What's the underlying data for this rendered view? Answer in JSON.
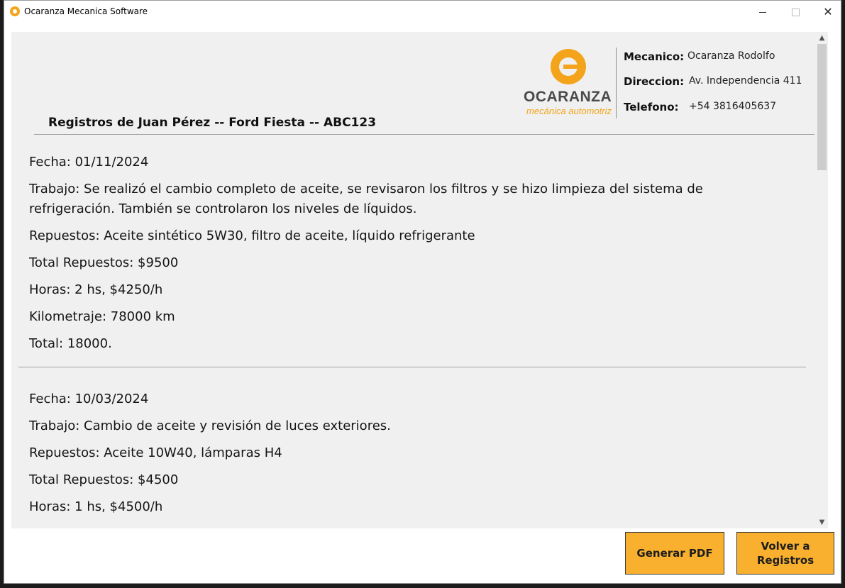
{
  "window": {
    "title": "Ocaranza Mecanica Software"
  },
  "logo": {
    "name": "OCARANZA",
    "subtitle": "mecánica automotriz"
  },
  "info": {
    "mecanico_label": "Mecanico:",
    "mecanico_value": "Ocaranza Rodolfo",
    "direccion_label": "Direccion:",
    "direccion_value": "Av. Independencia 411",
    "telefono_label": "Telefono:",
    "telefono_value": "+54 3816405637"
  },
  "records_title": "Registros de Juan Pérez -- Ford Fiesta -- ABC123",
  "records": [
    {
      "fecha": "Fecha: 01/11/2024",
      "trabajo_line1": "Trabajo: Se realizó el cambio completo de aceite, se revisaron los filtros y se hizo limpieza del sistema de",
      "trabajo_line2": "refrigeración. También se controlaron los niveles de líquidos.",
      "repuestos": "Repuestos: Aceite sintético 5W30, filtro de aceite, líquido refrigerante",
      "total_repuestos": "Total Repuestos: $9500",
      "horas": "Horas: 2 hs, $4250/h",
      "kilometraje": "Kilometraje: 78000 km",
      "total": "Total: 18000."
    },
    {
      "fecha": "Fecha: 10/03/2024",
      "trabajo": "Trabajo: Cambio de aceite y revisión de luces exteriores.",
      "repuestos": "Repuestos: Aceite 10W40, lámparas H4",
      "total_repuestos": "Total Repuestos: $4500",
      "horas": "Horas: 1 hs, $4500/h"
    }
  ],
  "buttons": {
    "generar_pdf": "Generar PDF",
    "volver_line1": "Volver a",
    "volver_line2": "Registros"
  }
}
